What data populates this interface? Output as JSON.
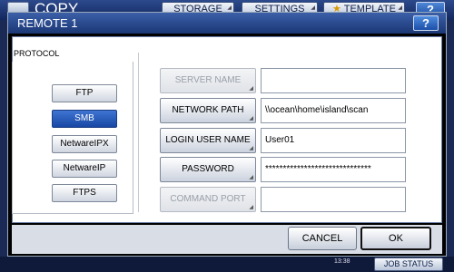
{
  "app": {
    "title": "COPY",
    "tabs": [
      {
        "label": "STORAGE"
      },
      {
        "label": "SETTINGS"
      },
      {
        "label": "TEMPLATE"
      }
    ],
    "help_label": "?"
  },
  "dialog": {
    "title": "REMOTE 1",
    "help_label": "?",
    "protocol_label": "PROTOCOL",
    "protocols": [
      {
        "label": "FTP",
        "selected": false
      },
      {
        "label": "SMB",
        "selected": true
      },
      {
        "label": "NetwareIPX",
        "selected": false
      },
      {
        "label": "NetwareIP",
        "selected": false
      },
      {
        "label": "FTPS",
        "selected": false
      }
    ],
    "fields": [
      {
        "label": "SERVER NAME",
        "value": "",
        "enabled": false
      },
      {
        "label": "NETWORK PATH",
        "value": "\\\\ocean\\home\\island\\scan",
        "enabled": true
      },
      {
        "label": "LOGIN USER NAME",
        "value": "User01",
        "enabled": true
      },
      {
        "label": "PASSWORD",
        "value": "******************************",
        "enabled": true
      },
      {
        "label": "COMMAND PORT",
        "value": "",
        "enabled": false
      }
    ],
    "cancel_label": "CANCEL",
    "ok_label": "OK"
  },
  "status": {
    "time": "13:38",
    "job_status_label": "JOB STATUS"
  },
  "colors": {
    "accent": "#1747a4",
    "header": "#1b3775"
  }
}
